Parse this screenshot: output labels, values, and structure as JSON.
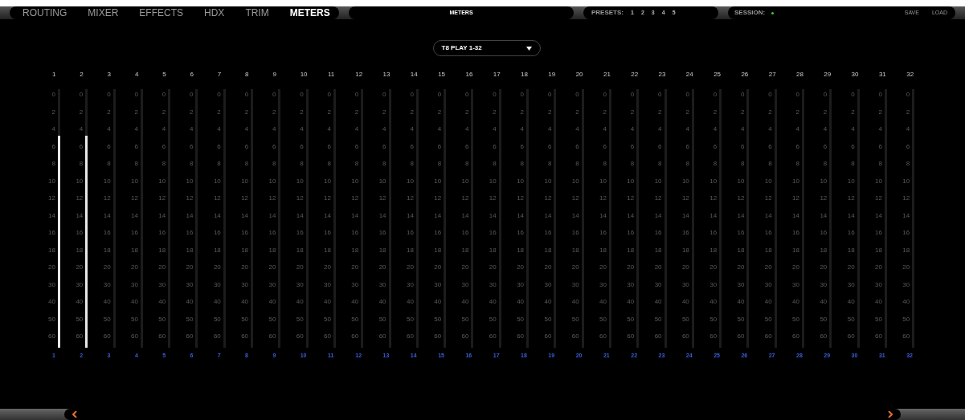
{
  "tabs": [
    {
      "label": "ROUTING",
      "selected": false
    },
    {
      "label": "MIXER",
      "selected": false
    },
    {
      "label": "EFFECTS",
      "selected": false
    },
    {
      "label": "HDX",
      "selected": false
    },
    {
      "label": "TRIM",
      "selected": false
    },
    {
      "label": "METERS",
      "selected": true
    }
  ],
  "page_title": "METERS",
  "presets": {
    "label": "PRESETS:",
    "items": [
      "1",
      "2",
      "3",
      "4",
      "5"
    ]
  },
  "session": {
    "label": "SESSION:",
    "active": true
  },
  "actions": [
    "SAVE",
    "LOAD"
  ],
  "source_select": {
    "value": "T8 PLAY 1-32"
  },
  "channels": [
    {
      "label": "1",
      "level": 0.82,
      "scale": [
        "0",
        "2",
        "4",
        "6",
        "8",
        "10",
        "12",
        "14",
        "16",
        "18",
        "20",
        "30",
        "40",
        "50",
        "60"
      ],
      "footer": "1"
    },
    {
      "label": "2",
      "level": 0.82,
      "scale": [
        "0",
        "2",
        "4",
        "6",
        "8",
        "10",
        "12",
        "14",
        "16",
        "18",
        "20",
        "30",
        "40",
        "50",
        "60"
      ],
      "footer": "2"
    },
    {
      "label": "3",
      "scale": [
        "0",
        "2",
        "4",
        "6",
        "8",
        "10",
        "12",
        "14",
        "16",
        "18",
        "20",
        "30",
        "40",
        "50",
        "60"
      ],
      "footer": "3"
    },
    {
      "label": "4",
      "scale": [
        "0",
        "2",
        "4",
        "6",
        "8",
        "10",
        "12",
        "14",
        "16",
        "18",
        "20",
        "30",
        "40",
        "50",
        "60"
      ],
      "footer": "4"
    },
    {
      "label": "5",
      "scale": [
        "0",
        "2",
        "4",
        "6",
        "8",
        "10",
        "12",
        "14",
        "16",
        "18",
        "20",
        "30",
        "40",
        "50",
        "60"
      ],
      "footer": "5"
    },
    {
      "label": "6",
      "scale": [
        "0",
        "2",
        "4",
        "6",
        "8",
        "10",
        "12",
        "14",
        "16",
        "18",
        "20",
        "30",
        "40",
        "50",
        "60"
      ],
      "footer": "6"
    },
    {
      "label": "7",
      "scale": [
        "0",
        "2",
        "4",
        "6",
        "8",
        "10",
        "12",
        "14",
        "16",
        "18",
        "20",
        "30",
        "40",
        "50",
        "60"
      ],
      "footer": "7"
    },
    {
      "label": "8",
      "scale": [
        "0",
        "2",
        "4",
        "6",
        "8",
        "10",
        "12",
        "14",
        "16",
        "18",
        "20",
        "30",
        "40",
        "50",
        "60"
      ],
      "footer": "8"
    },
    {
      "label": "9",
      "scale": [
        "0",
        "2",
        "4",
        "6",
        "8",
        "10",
        "12",
        "14",
        "16",
        "18",
        "20",
        "30",
        "40",
        "50",
        "60"
      ],
      "footer": "9"
    },
    {
      "label": "10",
      "scale": [
        "0",
        "2",
        "4",
        "6",
        "8",
        "10",
        "12",
        "14",
        "16",
        "18",
        "20",
        "30",
        "40",
        "50",
        "60"
      ],
      "footer": "10"
    },
    {
      "label": "11",
      "scale": [
        "0",
        "2",
        "4",
        "6",
        "8",
        "10",
        "12",
        "14",
        "16",
        "18",
        "20",
        "30",
        "40",
        "50",
        "60"
      ],
      "footer": "11"
    },
    {
      "label": "12",
      "scale": [
        "0",
        "2",
        "4",
        "6",
        "8",
        "10",
        "12",
        "14",
        "16",
        "18",
        "20",
        "30",
        "40",
        "50",
        "60"
      ],
      "footer": "12"
    },
    {
      "label": "13",
      "scale": [
        "0",
        "2",
        "4",
        "6",
        "8",
        "10",
        "12",
        "14",
        "16",
        "18",
        "20",
        "30",
        "40",
        "50",
        "60"
      ],
      "footer": "13"
    },
    {
      "label": "14",
      "scale": [
        "0",
        "2",
        "4",
        "6",
        "8",
        "10",
        "12",
        "14",
        "16",
        "18",
        "20",
        "30",
        "40",
        "50",
        "60"
      ],
      "footer": "14"
    },
    {
      "label": "15",
      "scale": [
        "0",
        "2",
        "4",
        "6",
        "8",
        "10",
        "12",
        "14",
        "16",
        "18",
        "20",
        "30",
        "40",
        "50",
        "60"
      ],
      "footer": "15"
    },
    {
      "label": "16",
      "scale": [
        "0",
        "2",
        "4",
        "6",
        "8",
        "10",
        "12",
        "14",
        "16",
        "18",
        "20",
        "30",
        "40",
        "50",
        "60"
      ],
      "footer": "16"
    },
    {
      "label": "17",
      "scale": [
        "0",
        "2",
        "4",
        "6",
        "8",
        "10",
        "12",
        "14",
        "16",
        "18",
        "20",
        "30",
        "40",
        "50",
        "60"
      ],
      "footer": "17"
    },
    {
      "label": "18",
      "scale": [
        "0",
        "2",
        "4",
        "6",
        "8",
        "10",
        "12",
        "14",
        "16",
        "18",
        "20",
        "30",
        "40",
        "50",
        "60"
      ],
      "footer": "18"
    },
    {
      "label": "19",
      "scale": [
        "0",
        "2",
        "4",
        "6",
        "8",
        "10",
        "12",
        "14",
        "16",
        "18",
        "20",
        "30",
        "40",
        "50",
        "60"
      ],
      "footer": "19"
    },
    {
      "label": "20",
      "scale": [
        "0",
        "2",
        "4",
        "6",
        "8",
        "10",
        "12",
        "14",
        "16",
        "18",
        "20",
        "30",
        "40",
        "50",
        "60"
      ],
      "footer": "20"
    },
    {
      "label": "21",
      "scale": [
        "0",
        "2",
        "4",
        "6",
        "8",
        "10",
        "12",
        "14",
        "16",
        "18",
        "20",
        "30",
        "40",
        "50",
        "60"
      ],
      "footer": "21"
    },
    {
      "label": "22",
      "scale": [
        "0",
        "2",
        "4",
        "6",
        "8",
        "10",
        "12",
        "14",
        "16",
        "18",
        "20",
        "30",
        "40",
        "50",
        "60"
      ],
      "footer": "22"
    },
    {
      "label": "23",
      "scale": [
        "0",
        "2",
        "4",
        "6",
        "8",
        "10",
        "12",
        "14",
        "16",
        "18",
        "20",
        "30",
        "40",
        "50",
        "60"
      ],
      "footer": "23"
    },
    {
      "label": "24",
      "scale": [
        "0",
        "2",
        "4",
        "6",
        "8",
        "10",
        "12",
        "14",
        "16",
        "18",
        "20",
        "30",
        "40",
        "50",
        "60"
      ],
      "footer": "24"
    },
    {
      "label": "25",
      "scale": [
        "0",
        "2",
        "4",
        "6",
        "8",
        "10",
        "12",
        "14",
        "16",
        "18",
        "20",
        "30",
        "40",
        "50",
        "60"
      ],
      "footer": "25"
    },
    {
      "label": "26",
      "scale": [
        "0",
        "2",
        "4",
        "6",
        "8",
        "10",
        "12",
        "14",
        "16",
        "18",
        "20",
        "30",
        "40",
        "50",
        "60"
      ],
      "footer": "26"
    },
    {
      "label": "27",
      "scale": [
        "0",
        "2",
        "4",
        "6",
        "8",
        "10",
        "12",
        "14",
        "16",
        "18",
        "20",
        "30",
        "40",
        "50",
        "60"
      ],
      "footer": "27"
    },
    {
      "label": "28",
      "scale": [
        "0",
        "2",
        "4",
        "6",
        "8",
        "10",
        "12",
        "14",
        "16",
        "18",
        "20",
        "30",
        "40",
        "50",
        "60"
      ],
      "footer": "28"
    },
    {
      "label": "29",
      "scale": [
        "0",
        "2",
        "4",
        "6",
        "8",
        "10",
        "12",
        "14",
        "16",
        "18",
        "20",
        "30",
        "40",
        "50",
        "60"
      ],
      "footer": "29"
    },
    {
      "label": "30",
      "scale": [
        "0",
        "2",
        "4",
        "6",
        "8",
        "10",
        "12",
        "14",
        "16",
        "18",
        "20",
        "30",
        "40",
        "50",
        "60"
      ],
      "footer": "30"
    },
    {
      "label": "31",
      "scale": [
        "0",
        "2",
        "4",
        "6",
        "8",
        "10",
        "12",
        "14",
        "16",
        "18",
        "20",
        "30",
        "40",
        "50",
        "60"
      ],
      "footer": "31"
    },
    {
      "label": "32",
      "scale": [
        "0",
        "2",
        "4",
        "6",
        "8",
        "10",
        "12",
        "14",
        "16",
        "18",
        "20",
        "30",
        "40",
        "50",
        "60"
      ],
      "footer": "32"
    }
  ]
}
